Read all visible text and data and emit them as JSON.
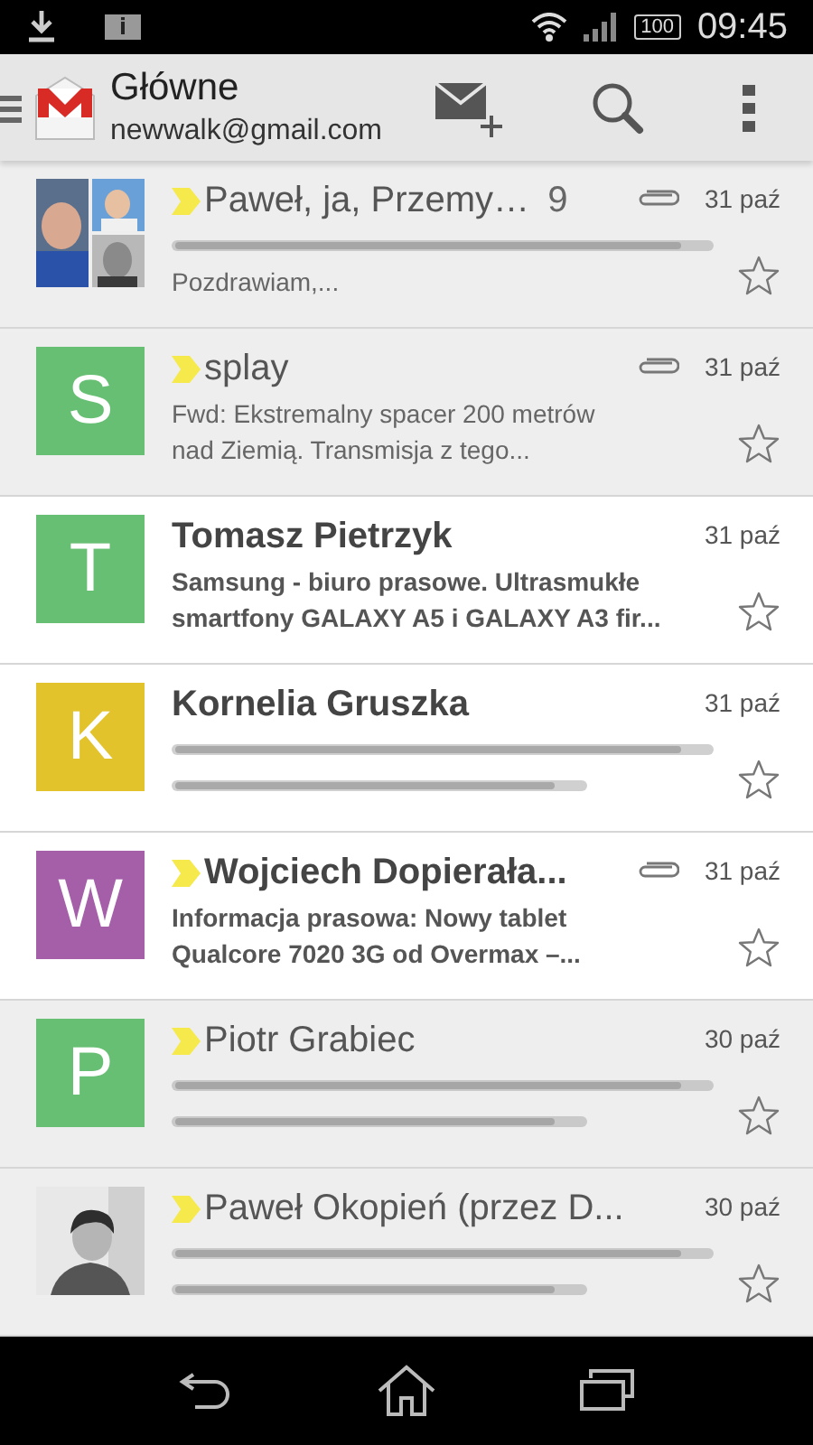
{
  "status_bar": {
    "battery": "100",
    "time": "09:45"
  },
  "app_bar": {
    "title": "Główne",
    "account": "newwalk@gmail.com"
  },
  "messages": [
    {
      "sender": "Paweł, ja, Przemy…",
      "count": "9",
      "unread": false,
      "important": true,
      "attachment": true,
      "date": "31 paź",
      "starred": false,
      "snippet": [
        {
          "kind": "blurred"
        },
        {
          "kind": "text",
          "text": "Pozdrawiam,..."
        }
      ]
    },
    {
      "sender": "splay",
      "unread": false,
      "important": true,
      "attachment": true,
      "date": "31 paź",
      "starred": false,
      "avatar": {
        "kind": "letter",
        "letter": "S",
        "color": "#66bf72"
      },
      "snippet": [
        {
          "kind": "text",
          "text": "Fwd: Ekstremalny spacer 200 metrów"
        },
        {
          "kind": "text",
          "text": "nad Ziemią. Transmisja z tego..."
        }
      ]
    },
    {
      "sender": "Tomasz Pietrzyk",
      "unread": true,
      "important": false,
      "attachment": false,
      "date": "31 paź",
      "starred": false,
      "avatar": {
        "kind": "letter",
        "letter": "T",
        "color": "#66bf72"
      },
      "snippet": [
        {
          "kind": "text",
          "text": "Samsung - biuro prasowe. Ultrasmukłe"
        },
        {
          "kind": "text",
          "text": "smartfony GALAXY A5 i GALAXY A3 fir..."
        }
      ]
    },
    {
      "sender": "Kornelia Gruszka",
      "unread": true,
      "important": false,
      "attachment": false,
      "date": "31 paź",
      "starred": false,
      "avatar": {
        "kind": "letter",
        "letter": "K",
        "color": "#e2c32b"
      },
      "snippet": [
        {
          "kind": "blurred"
        },
        {
          "kind": "blurred"
        }
      ]
    },
    {
      "sender": "Wojciech Dopierała...",
      "unread": true,
      "important": true,
      "attachment": true,
      "date": "31 paź",
      "starred": false,
      "avatar": {
        "kind": "letter",
        "letter": "W",
        "color": "#a55fa9"
      },
      "snippet": [
        {
          "kind": "text",
          "text": "Informacja prasowa: Nowy tablet"
        },
        {
          "kind": "text",
          "text": "Qualcore 7020 3G od Overmax –..."
        }
      ]
    },
    {
      "sender": "Piotr Grabiec",
      "unread": false,
      "important": true,
      "attachment": false,
      "date": "30 paź",
      "starred": false,
      "avatar": {
        "kind": "letter",
        "letter": "P",
        "color": "#66bf72"
      },
      "snippet": [
        {
          "kind": "blurred"
        },
        {
          "kind": "blurred"
        }
      ]
    },
    {
      "sender": "Paweł Okopień (przez D...",
      "unread": false,
      "important": true,
      "attachment": false,
      "date": "30 paź",
      "starred": false,
      "snippet": [
        {
          "kind": "blurred"
        },
        {
          "kind": "blurred"
        }
      ]
    }
  ]
}
